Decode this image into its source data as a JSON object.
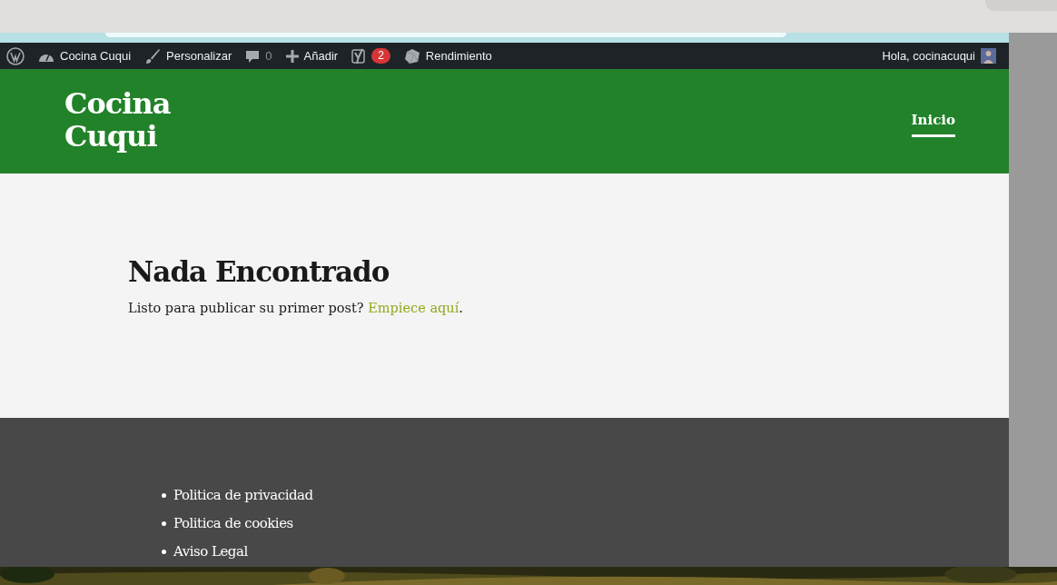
{
  "admin_bar": {
    "items": [
      {
        "kind": "wordpress"
      },
      {
        "kind": "dashboard",
        "label": "Cocina Cuqui"
      },
      {
        "kind": "brush",
        "label": "Personalizar"
      },
      {
        "kind": "comments",
        "label": "0"
      },
      {
        "kind": "plus",
        "label": "Añadir"
      },
      {
        "kind": "seo",
        "badge": "2"
      },
      {
        "kind": "performance",
        "label": "Rendimiento"
      }
    ],
    "greeting": "Hola, cocinacuqui"
  },
  "header": {
    "site_title_lines": [
      "Cocina",
      "Cuqui"
    ],
    "nav": [
      {
        "label": "Inicio",
        "selected": true
      }
    ]
  },
  "content": {
    "heading": "Nada Encontrado",
    "text": "Listo para publicar su primer post?",
    "link": "Empiece aquí",
    "after_link": "."
  },
  "footer": {
    "links": [
      "Politica de privacidad",
      "Politica de cookies",
      "Aviso Legal"
    ]
  }
}
